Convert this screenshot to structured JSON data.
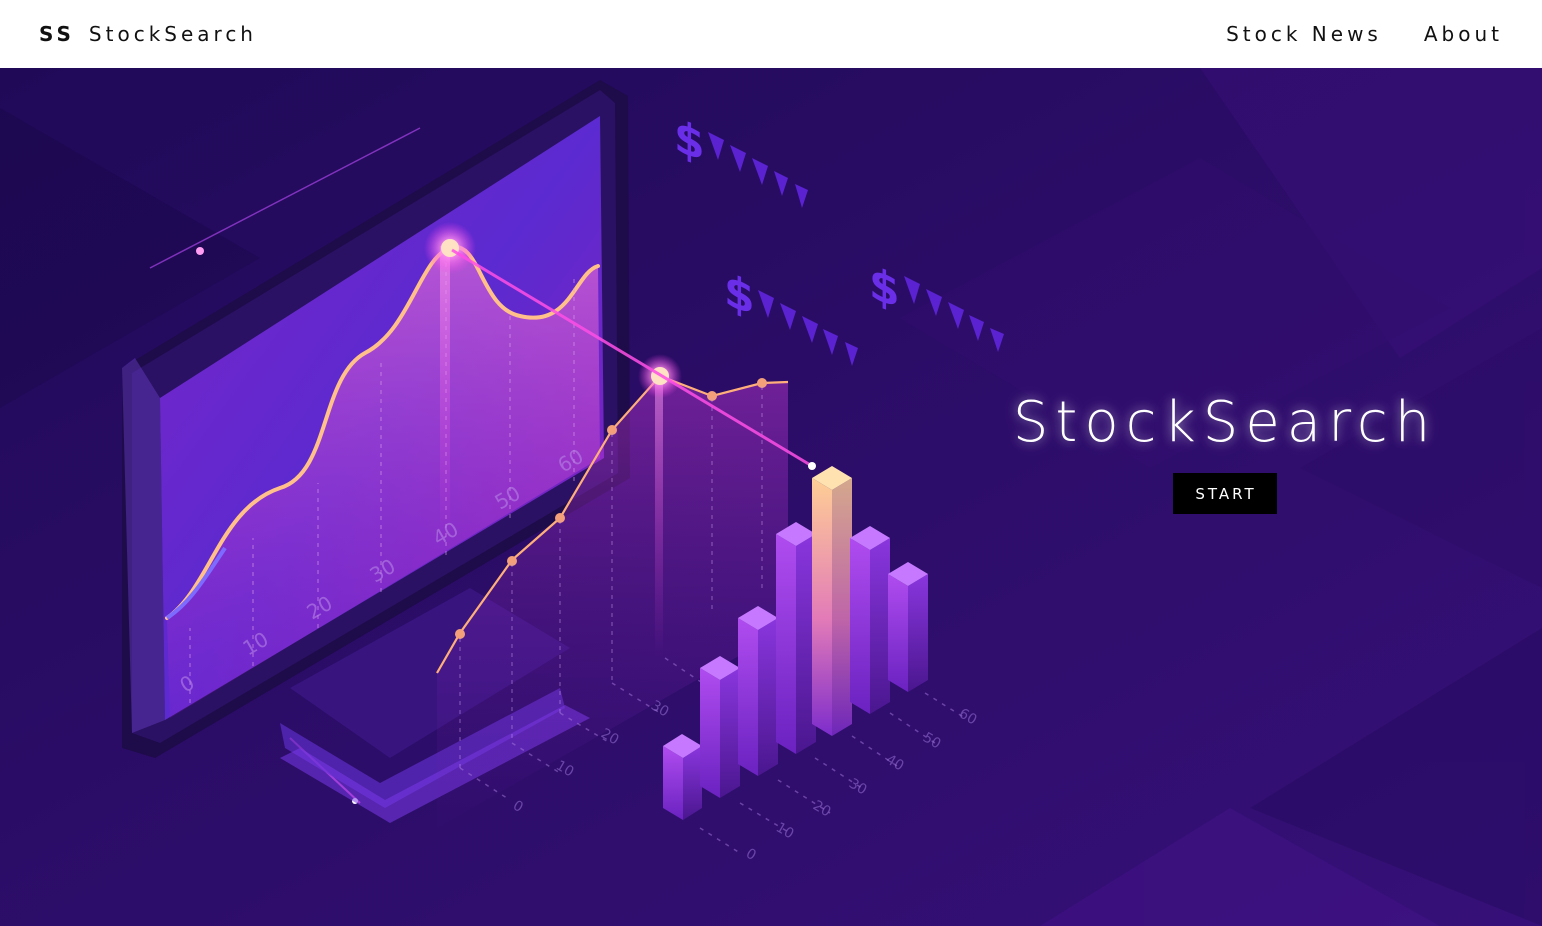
{
  "nav": {
    "logo": "SS",
    "brand": "StockSearch",
    "links": [
      "Stock News",
      "About"
    ]
  },
  "hero": {
    "title": "StockSearch",
    "cta": "START"
  },
  "illustration": {
    "screen_ticks": [
      "0",
      "10",
      "20",
      "30",
      "40",
      "50",
      "60"
    ],
    "floor_ticks": [
      "0",
      "10",
      "20",
      "30"
    ],
    "bar_ticks": [
      "0",
      "10",
      "20",
      "30",
      "40",
      "50",
      "60"
    ],
    "currency_symbol": "$"
  },
  "colors": {
    "background": "#2a0d66",
    "accent_pink": "#ff3de8",
    "accent_peach": "#ffc08a",
    "button": "#000000"
  }
}
